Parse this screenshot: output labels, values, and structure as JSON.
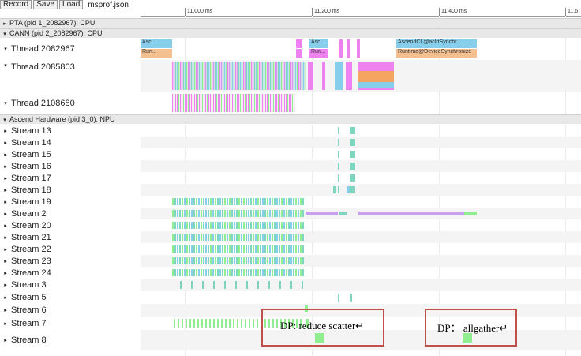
{
  "toolbar": {
    "record_label": "Record",
    "save_label": "Save",
    "load_label": "Load",
    "filename": "msprof.json"
  },
  "ruler": {
    "ticks": [
      "11,000 ms",
      "11,200 ms",
      "11,400 ms",
      "11,6"
    ]
  },
  "sections": {
    "pta": "PTA (pid 1_2082967): CPU",
    "cann": "CANN (pid 2_2082967): CPU",
    "ascend": "Ascend Hardware (pid 3_0): NPU"
  },
  "threads": [
    {
      "label": "Thread 2082967"
    },
    {
      "label": "Thread 2085803"
    },
    {
      "label": "Thread 2108680"
    }
  ],
  "thread_slices": {
    "asc1": "Asc...",
    "run1": "Run...",
    "asc2": "Asc...",
    "run2": "Run...",
    "acl": "AscendCL@aclrtSynchr...",
    "rt": "Runtime@DeviceSynchronize"
  },
  "streams": [
    {
      "label": "Stream 13"
    },
    {
      "label": "Stream 14"
    },
    {
      "label": "Stream 15"
    },
    {
      "label": "Stream 16"
    },
    {
      "label": "Stream 17"
    },
    {
      "label": "Stream 18"
    },
    {
      "label": "Stream 19"
    },
    {
      "label": "Stream 2"
    },
    {
      "label": "Stream 20"
    },
    {
      "label": "Stream 21"
    },
    {
      "label": "Stream 22"
    },
    {
      "label": "Stream 23"
    },
    {
      "label": "Stream 24"
    },
    {
      "label": "Stream 3"
    },
    {
      "label": "Stream 5"
    },
    {
      "label": "Stream 6"
    },
    {
      "label": "Stream 7"
    },
    {
      "label": "Stream 8"
    }
  ],
  "annotations": {
    "reduce_scatter": "DP: reduce scatter↵",
    "allgather": "DP： allgather↵"
  },
  "colors": {
    "pink": "#ee82ee",
    "blue": "#87ceeb",
    "green": "#90ee90",
    "teal": "#7fd6c0",
    "salmon": "#f4a460",
    "lavender": "#c9a0f0",
    "accent_box": "#c0504d"
  }
}
